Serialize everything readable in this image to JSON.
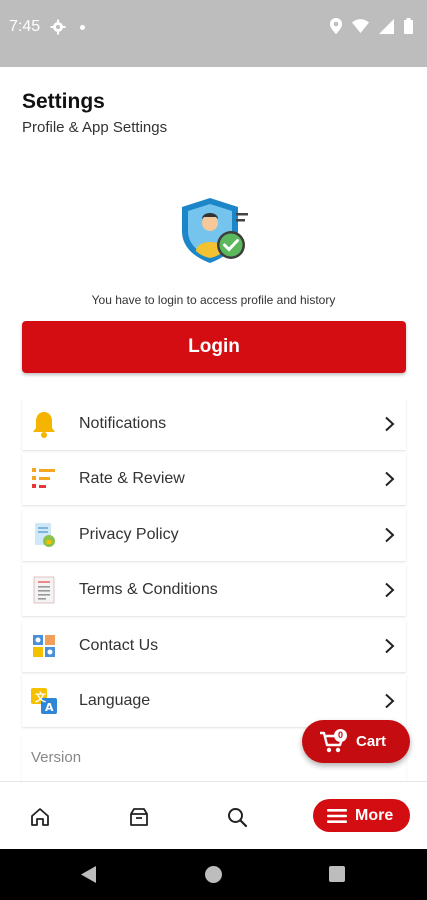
{
  "status_bar": {
    "time": "7:45"
  },
  "header": {
    "title": "Settings",
    "subtitle": "Profile & App Settings"
  },
  "login": {
    "message": "You have to login to access profile and history",
    "button_label": "Login"
  },
  "menu": {
    "items": [
      {
        "label": "Notifications",
        "icon": "bell-icon"
      },
      {
        "label": "Rate & Review",
        "icon": "rating-list-icon"
      },
      {
        "label": "Privacy Policy",
        "icon": "privacy-document-icon"
      },
      {
        "label": "Terms & Conditions",
        "icon": "terms-document-icon"
      },
      {
        "label": "Contact Us",
        "icon": "contact-icon"
      },
      {
        "label": "Language",
        "icon": "translate-icon"
      }
    ]
  },
  "version": {
    "label": "Version"
  },
  "cart": {
    "label": "Cart",
    "count": "0"
  },
  "bottom_nav": {
    "items": [
      {
        "icon": "home-icon"
      },
      {
        "icon": "orders-box-icon"
      },
      {
        "icon": "search-icon"
      }
    ],
    "more_label": "More"
  },
  "colors": {
    "accent": "#d40d12",
    "status_bar": "#bdbdbd"
  }
}
